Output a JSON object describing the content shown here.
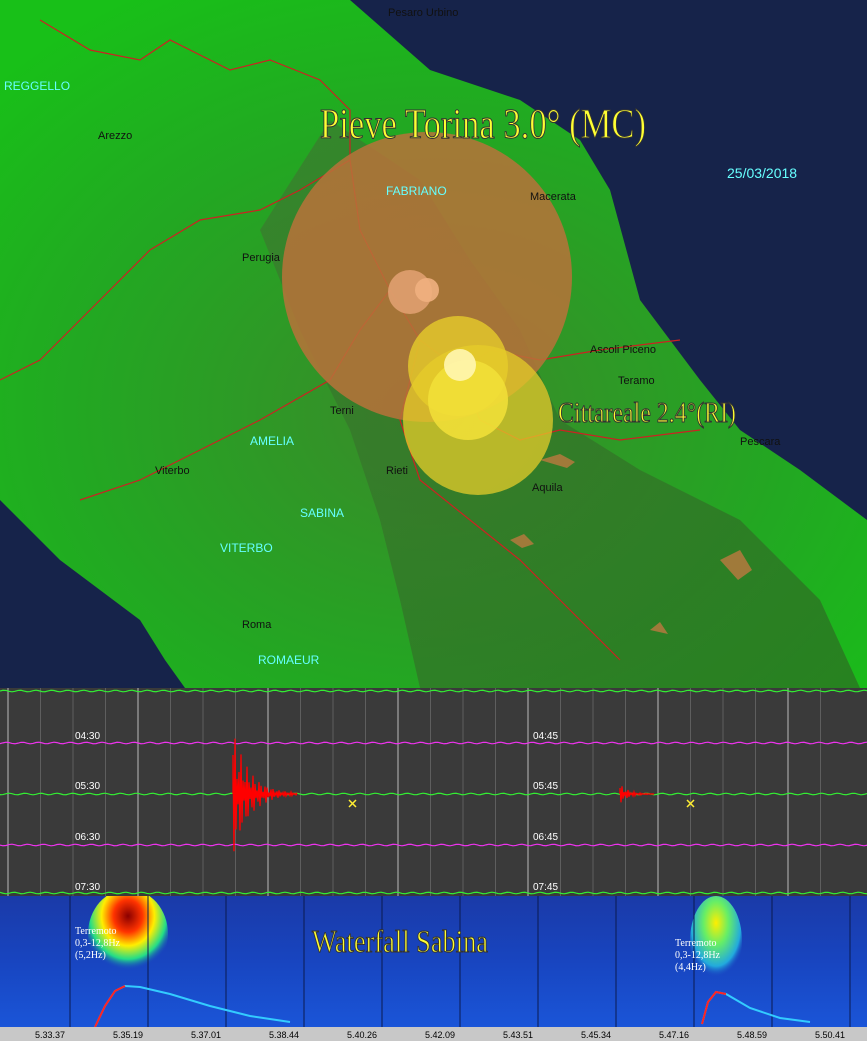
{
  "map": {
    "title_main": "Pieve Torina 3.0° (MC)",
    "title_secondary": "Cittareale 2.4°(RI)",
    "date": "25/03/2018",
    "cities_black": [
      {
        "name": "Pesaro Urbino"
      },
      {
        "name": "Arezzo"
      },
      {
        "name": "Macerata"
      },
      {
        "name": "Perugia"
      },
      {
        "name": "Ascoli Piceno"
      },
      {
        "name": "Teramo"
      },
      {
        "name": "Terni"
      },
      {
        "name": "Pescara"
      },
      {
        "name": "Viterbo"
      },
      {
        "name": "Rieti"
      },
      {
        "name": "Aquila"
      },
      {
        "name": "Roma"
      }
    ],
    "cities_cyan": [
      {
        "name": "REGGELLO"
      },
      {
        "name": "FABRIANO"
      },
      {
        "name": "AMELIA"
      },
      {
        "name": "SABINA"
      },
      {
        "name": "VITERBO"
      },
      {
        "name": "ROMAEUR"
      }
    ]
  },
  "seismogram": {
    "left_times": [
      "04:30",
      "05:30",
      "06:30",
      "07:30"
    ],
    "right_times": [
      "04:45",
      "05:45",
      "06:45",
      "07:45"
    ]
  },
  "waterfall": {
    "title": "Waterfall Sabina",
    "events": [
      {
        "label1": "Terremoto",
        "label2": "0,3-12,8Hz",
        "label3": "(5,2Hz)"
      },
      {
        "label1": "Terremoto",
        "label2": "0,3-12,8Hz",
        "label3": "(4,4Hz)"
      }
    ],
    "x_ticks": [
      "5.33.37",
      "5.35.19",
      "5.37.01",
      "5.38.44",
      "5.40.26",
      "5.42.09",
      "5.43.51",
      "5.45.34",
      "5.47.16",
      "5.48.59",
      "5.50.41"
    ]
  },
  "colors": {
    "trace_green": "#33ee33",
    "trace_magenta": "#ee33ee",
    "quake_red": "#ff0000",
    "title_yellow": "#ffff33"
  }
}
